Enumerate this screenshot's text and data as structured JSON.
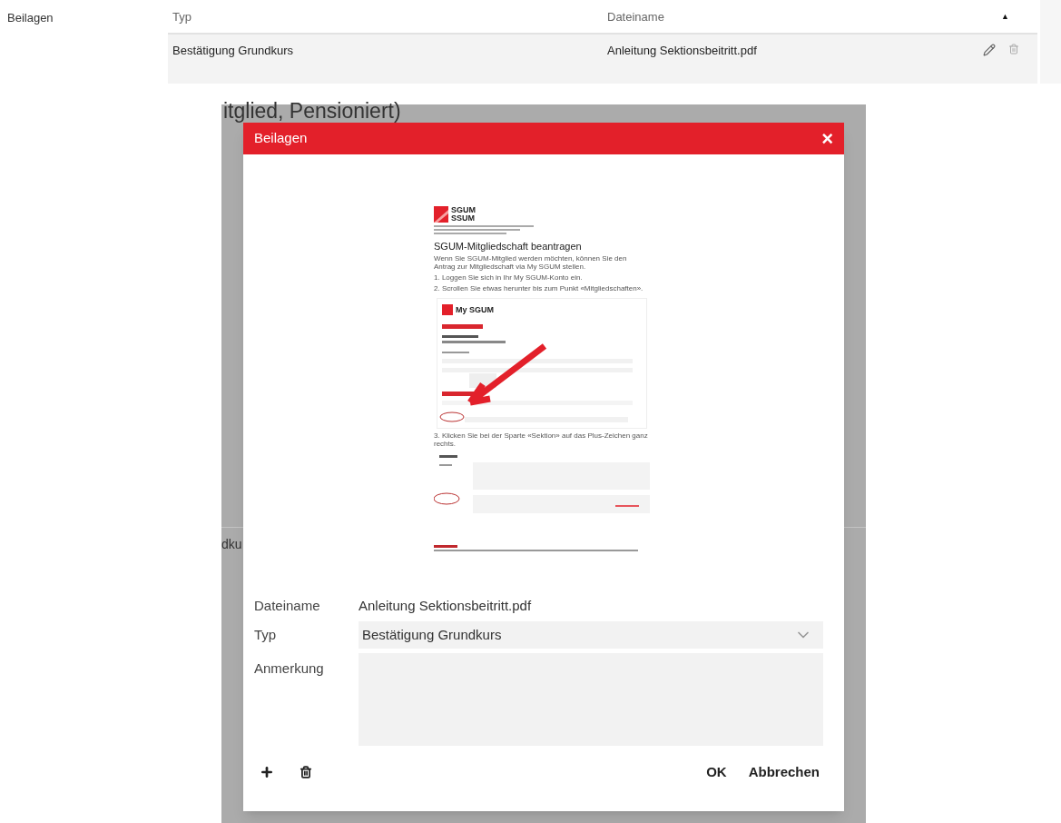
{
  "section_label": "Beilagen",
  "table": {
    "columns": [
      "Typ",
      "Dateiname"
    ],
    "sort_indicator": "▲",
    "rows": [
      {
        "typ": "Bestätigung Grundkurs",
        "dateiname": "Anleitung Sektionsbeitritt.pdf"
      }
    ]
  },
  "background_texts": [
    "itglied, Pensioniert)",
    "dku"
  ],
  "dialog": {
    "title": "Beilagen",
    "close": "×",
    "document": {
      "logo_lines": [
        "SGUM",
        "SSUM"
      ],
      "heading": "SGUM-Mitgliedschaft beantragen",
      "blocks": [
        {
          "kind": "paragraph",
          "text": "Wenn Sie SGUM-Mitglied werden möchten, können Sie den Antrag zur Mitgliedschaft via My SGUM stellen."
        },
        {
          "kind": "paragraph",
          "text": "1. Loggen Sie sich in Ihr My SGUM-Konto ein."
        },
        {
          "kind": "paragraph",
          "text": "2. Scrollen Sie etwas herunter bis zum Punkt «Mitgliedschaften»."
        },
        {
          "kind": "app_screenshot",
          "logo": "My SGUM"
        },
        {
          "kind": "paragraph",
          "text": "3. Klicken Sie bei der Sparte «Sektion» auf das Plus-Zeichen ganz rechts."
        },
        {
          "kind": "form_screenshot"
        }
      ]
    },
    "fields": [
      {
        "kind": "text",
        "label": "Dateiname",
        "value": "Anleitung Sektionsbeitritt.pdf"
      },
      {
        "kind": "select",
        "label": "Typ",
        "value": "Bestätigung Grundkurs"
      },
      {
        "kind": "textarea",
        "label": "Anmerkung"
      }
    ],
    "buttons": [
      "OK",
      "Abbrechen"
    ]
  }
}
